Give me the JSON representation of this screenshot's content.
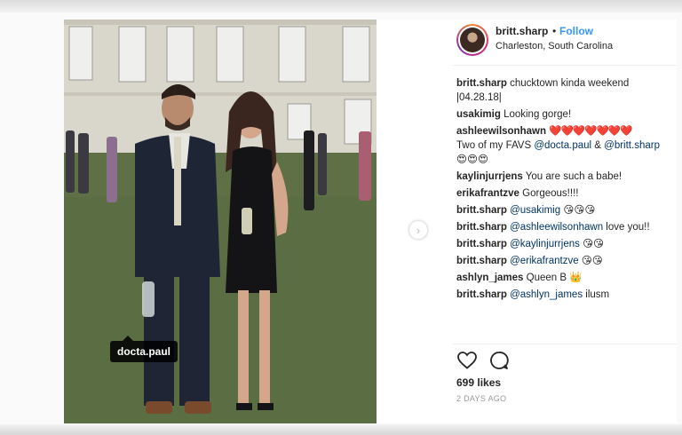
{
  "post": {
    "username": "britt.sharp",
    "separator": "•",
    "follow_label": "Follow",
    "location": "Charleston, South Carolina",
    "photo_tag": "docta.paul"
  },
  "comments": [
    {
      "user": "britt.sharp",
      "text": "chucktown kinda weekend |04.28.18|"
    },
    {
      "user": "usakimig",
      "text": "Looking gorge!"
    },
    {
      "user": "ashleewilsonhawn",
      "emoji": "❤️❤️❤️❤️❤️❤️❤️",
      "text": "Two of my FAVS ",
      "mention1": "@docta.paul",
      "mid": " & ",
      "mention2": "@britt.sharp",
      "tail": "😍😍😍"
    },
    {
      "user": "kaylinjurrjens",
      "text": "You are such a babe!"
    },
    {
      "user": "erikafrantzve",
      "text": "Gorgeous!!!!"
    },
    {
      "user": "britt.sharp",
      "mention": "@usakimig",
      "text": " 😘😘😘"
    },
    {
      "user": "britt.sharp",
      "mention": "@ashleewilsonhawn",
      "text": " love you!!"
    },
    {
      "user": "britt.sharp",
      "mention": "@kaylinjurrjens",
      "text": " 😘😘"
    },
    {
      "user": "britt.sharp",
      "mention": "@erikafrantzve",
      "text": " 😘😘"
    },
    {
      "user": "ashlyn_james",
      "text": "Queen B 👑"
    },
    {
      "user": "britt.sharp",
      "mention": "@ashlyn_james",
      "text": " ilusm"
    }
  ],
  "footer": {
    "likes": "699 likes",
    "time_ago": "2 DAYS AGO"
  },
  "icons": {
    "like": "heart-icon",
    "comment": "comment-icon",
    "next": "chevron-right-icon"
  }
}
